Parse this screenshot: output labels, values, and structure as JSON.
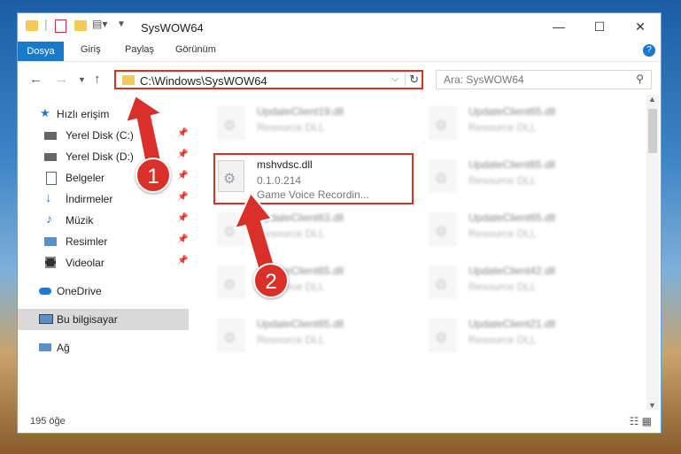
{
  "window": {
    "title": "SysWOW64"
  },
  "ribbon": {
    "tabs": [
      "Dosya",
      "Giriş",
      "Paylaş",
      "Görünüm"
    ]
  },
  "address": {
    "path": "C:\\Windows\\SysWOW64"
  },
  "search": {
    "placeholder": "Ara: SysWOW64"
  },
  "sidebar": {
    "items": [
      {
        "label": "Hızlı erişim",
        "icon": "star-icon"
      },
      {
        "label": "Yerel Disk (C:)",
        "icon": "drive-icon"
      },
      {
        "label": "Yerel Disk (D:)",
        "icon": "drive-icon"
      },
      {
        "label": "Belgeler",
        "icon": "document-icon"
      },
      {
        "label": "İndirmeler",
        "icon": "download-icon"
      },
      {
        "label": "Müzik",
        "icon": "music-icon"
      },
      {
        "label": "Resimler",
        "icon": "pictures-icon"
      },
      {
        "label": "Videolar",
        "icon": "video-icon"
      },
      {
        "label": "OneDrive",
        "icon": "cloud-icon"
      },
      {
        "label": "Bu bilgisayar",
        "icon": "computer-icon"
      },
      {
        "label": "Ağ",
        "icon": "network-icon"
      }
    ]
  },
  "files": [
    {
      "name": "UpdateClient19.dll",
      "type": "Resource DLL"
    },
    {
      "name": "UpdateClient65.dll",
      "type": "Resource DLL"
    },
    {
      "name": "mshvdsc.dll",
      "version": "0.1.0.214",
      "desc": "Game Voice Recordin..."
    },
    {
      "name": "UpdateClient65.dll",
      "type": "Resource DLL"
    },
    {
      "name": "UpdateClient63.dll",
      "type": "Resource DLL"
    },
    {
      "name": "UpdateClient65.dll",
      "type": "Resource DLL"
    },
    {
      "name": "UpdateClient65.dll",
      "type": "Resource DLL"
    },
    {
      "name": "UpdateClient42.dll",
      "type": "Resource DLL"
    },
    {
      "name": "UpdateClient65.dll",
      "type": "Resource DLL"
    },
    {
      "name": "UpdateClient21.dll",
      "type": "Resource DLL"
    }
  ],
  "status": {
    "count": "195 öğe"
  },
  "annotations": {
    "step1": "1",
    "step2": "2"
  }
}
